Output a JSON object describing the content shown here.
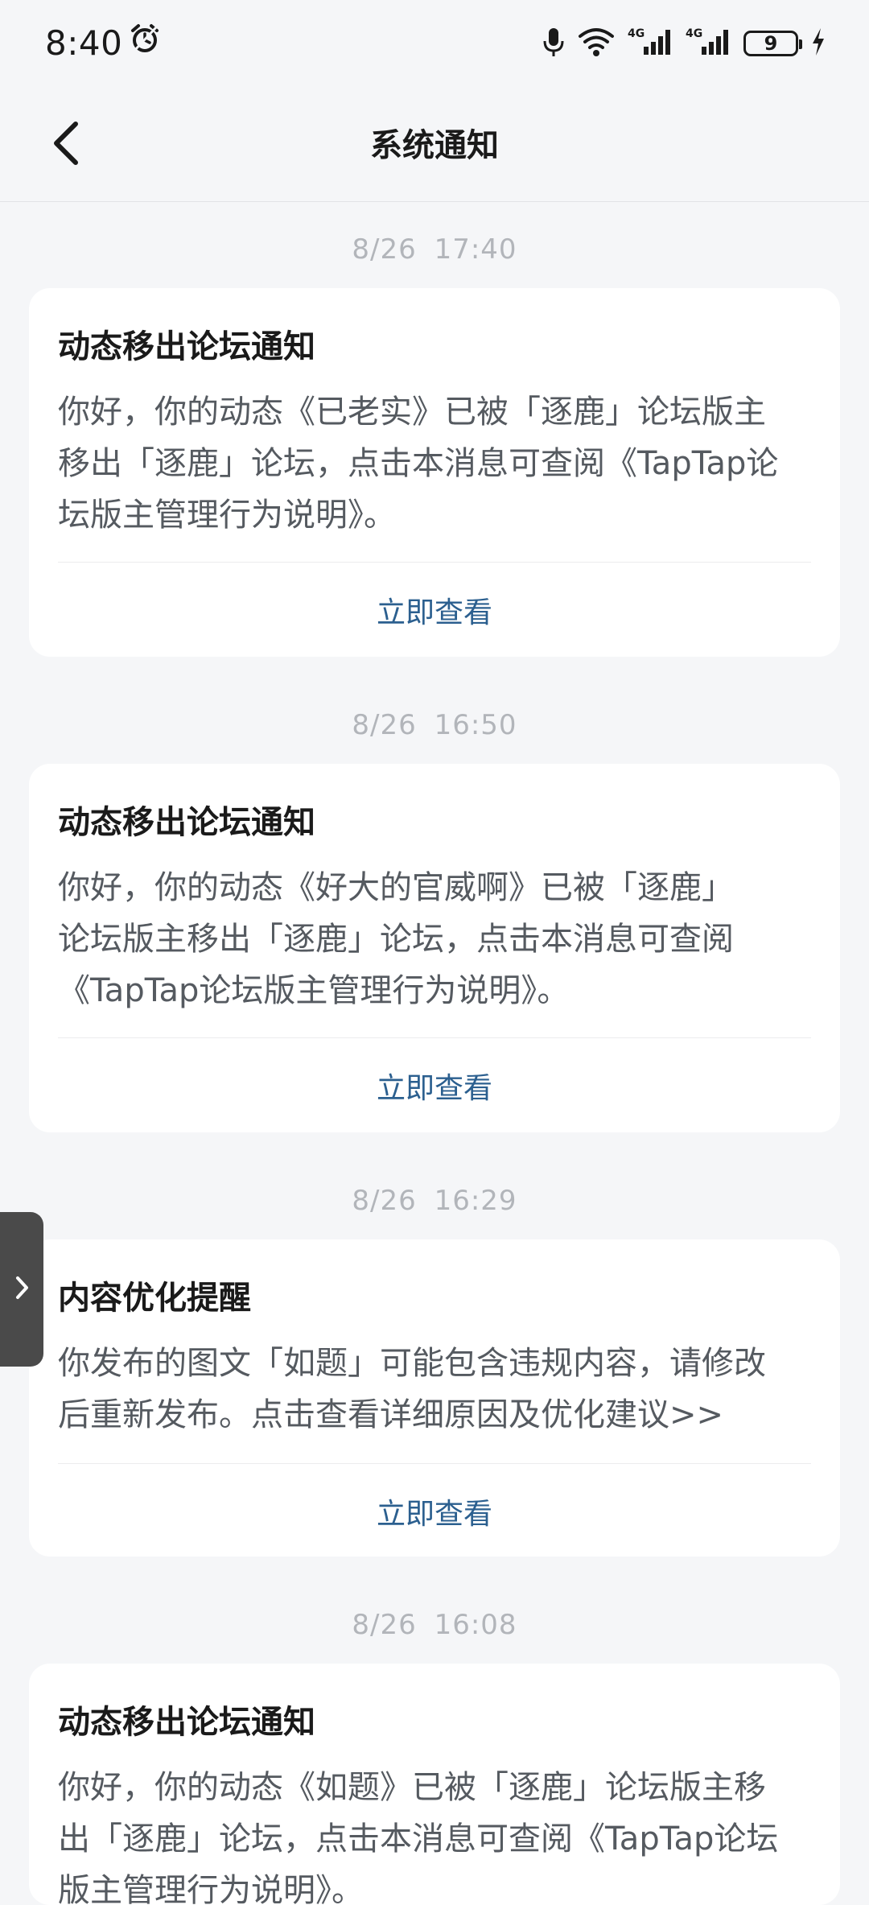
{
  "status_bar": {
    "time": "8:40",
    "battery": "9",
    "network1": "4G",
    "network2": "4G"
  },
  "header": {
    "title": "系统通知"
  },
  "notifications": [
    {
      "time": "8/26  17:40",
      "title": "动态移出论坛通知",
      "body": "你好，你的动态《已老实》已被「逐鹿」论坛版主\n移出「逐鹿」论坛，点击本消息可查阅《TapTap论\n坛版主管理行为说明》。",
      "action": "立即查看"
    },
    {
      "time": "8/26  16:50",
      "title": "动态移出论坛通知",
      "body": "你好，你的动态《好大的官威啊》已被「逐鹿」\n论坛版主移出「逐鹿」论坛，点击本消息可查阅\n《TapTap论坛版主管理行为说明》。",
      "action": "立即查看"
    },
    {
      "time": "8/26  16:29",
      "title": "内容优化提醒",
      "body": "你发布的图文「如题」可能包含违规内容，请修改\n后重新发布。点击查看详细原因及优化建议>>",
      "action": "立即查看"
    },
    {
      "time": "8/26  16:08",
      "title": "动态移出论坛通知",
      "body": "你好，你的动态《如题》已被「逐鹿」论坛版主移\n出「逐鹿」论坛，点击本消息可查阅《TapTap论坛\n版主管理行为说明》。",
      "action": "立即查看"
    }
  ],
  "icons": {
    "back": "chevron-left-icon",
    "alarm": "alarm-icon",
    "mic": "mic-icon",
    "wifi": "wifi-icon",
    "signal": "signal-icon",
    "charging": "charging-icon",
    "side_handle": "chevron-right-icon"
  },
  "colors": {
    "background": "#f5f6f8",
    "card": "#ffffff",
    "action": "#2b5f8f",
    "timestamp": "#b2b5ba"
  }
}
